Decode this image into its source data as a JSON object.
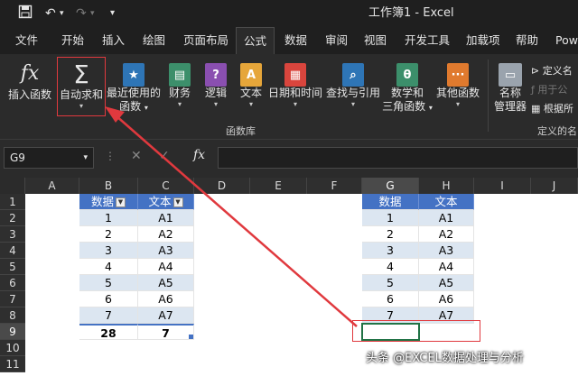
{
  "titlebar": {
    "title": "工作簿1 - Excel"
  },
  "tabs": [
    {
      "label": "文件"
    },
    {
      "label": "开始"
    },
    {
      "label": "插入"
    },
    {
      "label": "绘图"
    },
    {
      "label": "页面布局"
    },
    {
      "label": "公式"
    },
    {
      "label": "数据"
    },
    {
      "label": "审阅"
    },
    {
      "label": "视图"
    },
    {
      "label": "开发工具"
    },
    {
      "label": "加载项"
    },
    {
      "label": "帮助"
    },
    {
      "label": "Pow"
    }
  ],
  "ribbon": {
    "insert_function": "插入函数",
    "autosum": "自动求和",
    "recent": [
      "最近使用的",
      "函数"
    ],
    "financial": "财务",
    "logical": "逻辑",
    "text": "文本",
    "datetime": "日期和时间",
    "lookup": "查找与引用",
    "math": [
      "数学和",
      "三角函数"
    ],
    "other": "其他函数",
    "name_manager": [
      "名称",
      "管理器"
    ],
    "define_name": "定义名",
    "use_in_formula": "用于公",
    "create_from": "根据所",
    "group_library": "函数库",
    "group_names": "定义的名"
  },
  "formula_bar": {
    "name_box": "G9",
    "fx": "fx"
  },
  "columns": [
    "A",
    "B",
    "C",
    "D",
    "E",
    "F",
    "G",
    "H",
    "I",
    "J"
  ],
  "rows": [
    "1",
    "2",
    "3",
    "4",
    "5",
    "6",
    "7",
    "8",
    "9",
    "10",
    "11"
  ],
  "table_left": {
    "headers": [
      "数据",
      "文本"
    ],
    "rows": [
      [
        "1",
        "A1"
      ],
      [
        "2",
        "A2"
      ],
      [
        "3",
        "A3"
      ],
      [
        "4",
        "A4"
      ],
      [
        "5",
        "A5"
      ],
      [
        "6",
        "A6"
      ],
      [
        "7",
        "A7"
      ]
    ],
    "totals": [
      "28",
      "7"
    ]
  },
  "table_right": {
    "headers": [
      "数据",
      "文本"
    ],
    "rows": [
      [
        "1",
        "A1"
      ],
      [
        "2",
        "A2"
      ],
      [
        "3",
        "A3"
      ],
      [
        "4",
        "A4"
      ],
      [
        "5",
        "A5"
      ],
      [
        "6",
        "A6"
      ],
      [
        "7",
        "A7"
      ]
    ]
  },
  "watermark": "头条 @EXCEL数据处理与分析",
  "colors": {
    "table_header": "#4472c4",
    "table_band": "#dce6f1",
    "annotation": "#e0393e",
    "selection": "#217346"
  }
}
